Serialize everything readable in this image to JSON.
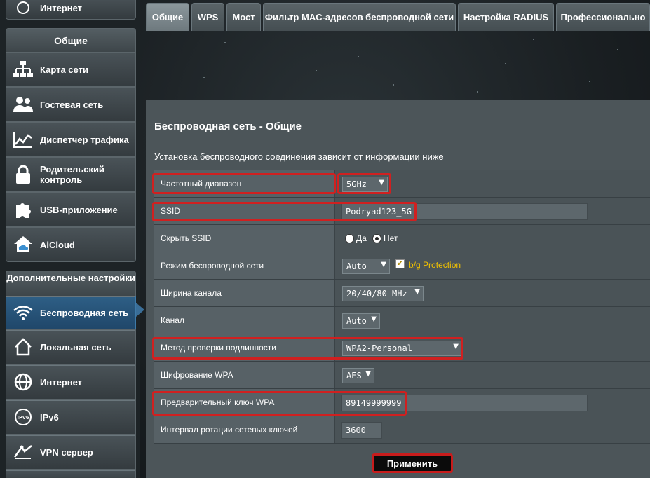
{
  "sidebar": {
    "top_item": {
      "label": "Интернет",
      "icon": "globe-icon"
    },
    "group_general": "Общие",
    "general_items": [
      {
        "label": "Карта сети",
        "icon": "network-map-icon"
      },
      {
        "label": "Гостевая сеть",
        "icon": "guest-users-icon"
      },
      {
        "label": "Диспетчер трафика",
        "icon": "traffic-chart-icon"
      },
      {
        "label": "Родительский контроль",
        "icon": "lock-icon"
      },
      {
        "label": "USB-приложение",
        "icon": "puzzle-icon"
      },
      {
        "label": "AiCloud",
        "icon": "cloud-home-icon"
      }
    ],
    "group_advanced": "Дополнительные настройки",
    "advanced_items": [
      {
        "label": "Беспроводная сеть",
        "icon": "wifi-icon",
        "active": true
      },
      {
        "label": "Локальная сеть",
        "icon": "home-icon"
      },
      {
        "label": "Интернет",
        "icon": "globe-icon"
      },
      {
        "label": "IPv6",
        "icon": "ipv6-icon"
      },
      {
        "label": "VPN сервер",
        "icon": "vpn-icon"
      }
    ]
  },
  "tabs": [
    {
      "label": "Общие",
      "active": true
    },
    {
      "label": "WPS"
    },
    {
      "label": "Мост"
    },
    {
      "label": "Фильтр MAC-адресов беспроводной сети"
    },
    {
      "label": "Настройка RADIUS"
    },
    {
      "label": "Профессионально"
    }
  ],
  "panel": {
    "title": "Беспроводная сеть - Общие",
    "description": "Установка беспроводного соединения зависит от информации ниже"
  },
  "form": {
    "band": {
      "label": "Частотный диапазон",
      "value": "5GHz"
    },
    "ssid": {
      "label": "SSID",
      "value": "Podryad123_5G"
    },
    "hide_ssid": {
      "label": "Скрыть SSID",
      "opt_yes": "Да",
      "opt_no": "Нет",
      "selected": "Нет"
    },
    "mode": {
      "label": "Режим беспроводной сети",
      "value": "Auto",
      "checkbox_label": "b/g Protection",
      "checked": true
    },
    "width": {
      "label": "Ширина канала",
      "value": "20/40/80 MHz"
    },
    "channel": {
      "label": "Канал",
      "value": "Auto"
    },
    "auth": {
      "label": "Метод проверки подлинности",
      "value": "WPA2-Personal"
    },
    "encryption": {
      "label": "Шифрование WPA",
      "value": "AES"
    },
    "psk": {
      "label": "Предварительный ключ WPA",
      "value": "89149999999"
    },
    "rekey": {
      "label": "Интервал ротации сетевых ключей",
      "value": "3600"
    }
  },
  "apply_label": "Применить",
  "colors": {
    "highlight": "#d02020",
    "active_menu": "#2e5f86",
    "accent_label": "#f2c200"
  }
}
